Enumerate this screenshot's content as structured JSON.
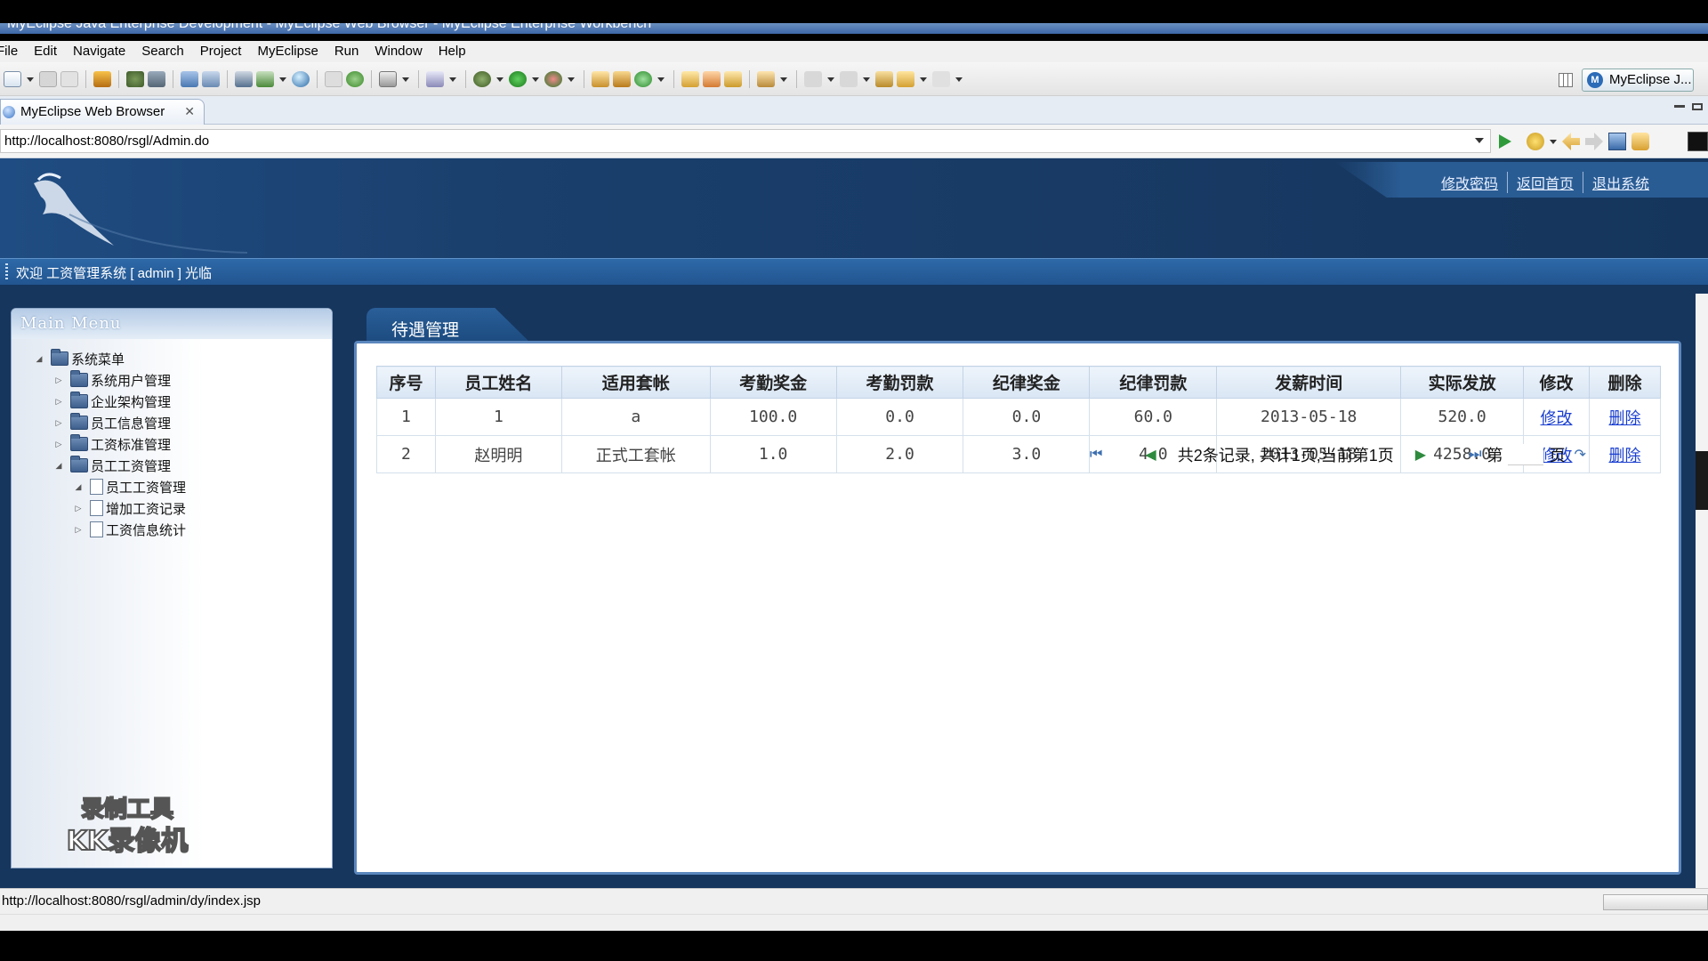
{
  "window": {
    "title": "MyEclipse Java Enterprise Development - MyEclipse Web Browser - MyEclipse Enterprise Workbench"
  },
  "menubar": {
    "items": [
      "File",
      "Edit",
      "Navigate",
      "Search",
      "Project",
      "MyEclipse",
      "Run",
      "Window",
      "Help"
    ]
  },
  "toolbar": {
    "perspective_label": "MyEclipse J..."
  },
  "browser": {
    "tab_label": "MyEclipse Web Browser",
    "tab_close": "✕",
    "url": "http://localhost:8080/rsgl/Admin.do"
  },
  "site": {
    "header_links": [
      "修改密码",
      "返回首页",
      "退出系统"
    ],
    "welcome": "欢迎 工资管理系统 [ admin ] 光临"
  },
  "menu": {
    "header": "Main Menu",
    "tree": [
      {
        "label": "系统菜单",
        "arrow": "◢",
        "icon": "folder-icon"
      },
      {
        "label": "系统用户管理",
        "arrow": "▷",
        "icon": "folder-icon"
      },
      {
        "label": "企业架构管理",
        "arrow": "▷",
        "icon": "folder-icon"
      },
      {
        "label": "员工信息管理",
        "arrow": "▷",
        "icon": "folder-icon"
      },
      {
        "label": "工资标准管理",
        "arrow": "▷",
        "icon": "folder-icon"
      },
      {
        "label": "员工工资管理",
        "arrow": "◢",
        "icon": "folder-icon"
      },
      {
        "label": "员工工资管理",
        "arrow": "◢",
        "icon": "page-icon"
      },
      {
        "label": "增加工资记录",
        "arrow": "▷",
        "icon": "page-icon"
      },
      {
        "label": "工资信息统计",
        "arrow": "▷",
        "icon": "page-icon"
      }
    ]
  },
  "watermark": {
    "line1": "录制工具",
    "line2": "KK录像机"
  },
  "content": {
    "tab_title": "待遇管理",
    "table": {
      "headers": [
        "序号",
        "员工姓名",
        "适用套帐",
        "考勤奖金",
        "考勤罚款",
        "纪律奖金",
        "纪律罚款",
        "发薪时间",
        "实际发放",
        "修改",
        "删除"
      ],
      "rows": [
        [
          "1",
          "1",
          "a",
          "100.0",
          "0.0",
          "0.0",
          "60.0",
          "2013-05-18",
          "520.0",
          "修改",
          "删除"
        ],
        [
          "2",
          "赵明明",
          "正式工套帐",
          "1.0",
          "2.0",
          "3.0",
          "4.0",
          "2013-05-18",
          "4258.0",
          "修改",
          "删除"
        ]
      ]
    },
    "pager": {
      "summary": "共2条记录, 共计1页,当前第1页",
      "page_prefix": "第",
      "page_suffix": "页",
      "page_value": ""
    }
  },
  "statusbar": {
    "text": "http://localhost:8080/rsgl/admin/dy/index.jsp"
  },
  "colors": {
    "banner": "#16365e",
    "welcome_bar": "#2a5f99",
    "table_header": "#d9e6f4",
    "link": "#1a3fd0"
  }
}
